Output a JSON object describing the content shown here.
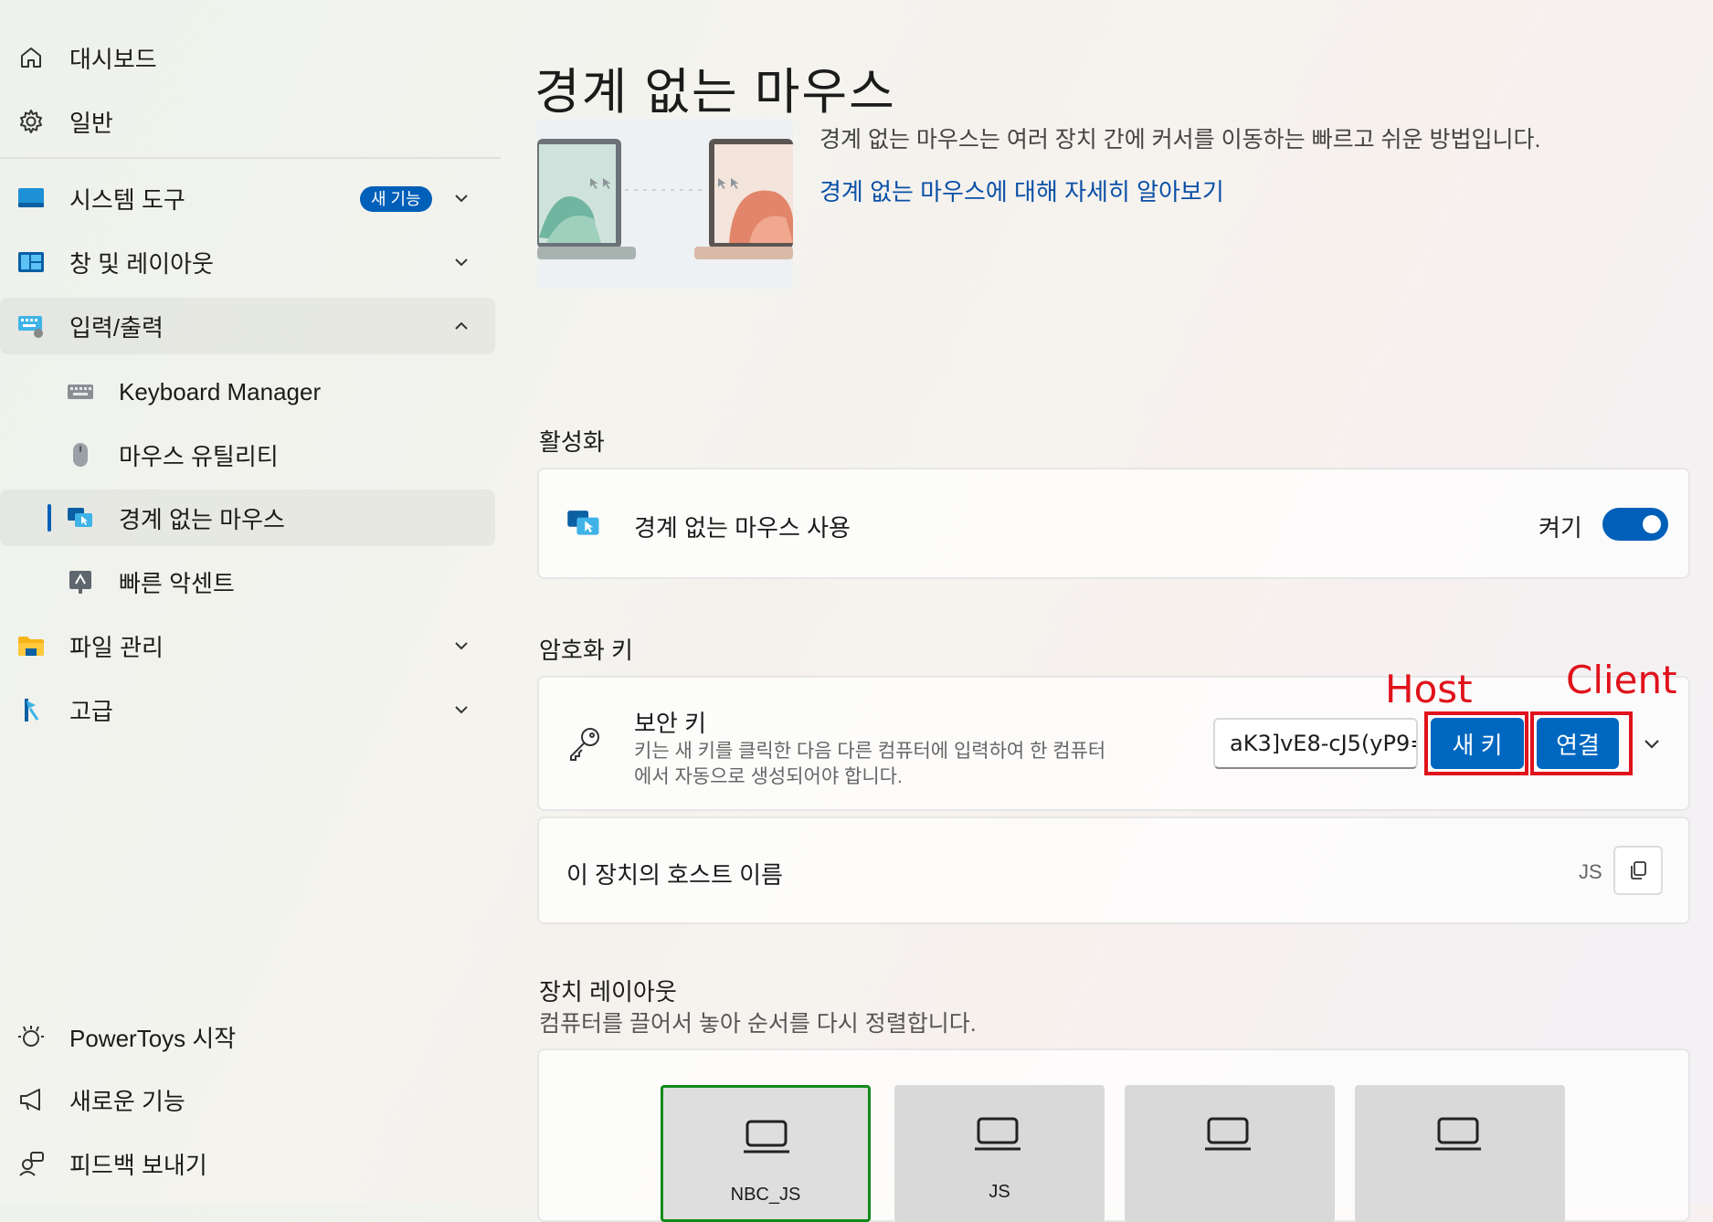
{
  "sidebar": {
    "items": [
      {
        "label": "대시보드",
        "icon": "home-icon"
      },
      {
        "label": "일반",
        "icon": "gear-icon"
      },
      {
        "label": "시스템 도구",
        "icon": "system-tools-icon",
        "badge": "새 기능"
      },
      {
        "label": "창 및 레이아웃",
        "icon": "window-layout-icon"
      },
      {
        "label": "입력/출력",
        "icon": "keyboard-icon",
        "expanded": true
      },
      {
        "label": "Keyboard Manager",
        "icon": "keyboard-manager-icon"
      },
      {
        "label": "마우스 유틸리티",
        "icon": "mouse-icon"
      },
      {
        "label": "경계 없는 마우스",
        "icon": "mouse-without-borders-icon",
        "selected": true
      },
      {
        "label": "빠른 악센트",
        "icon": "quick-accent-icon"
      },
      {
        "label": "파일 관리",
        "icon": "folder-icon"
      },
      {
        "label": "고급",
        "icon": "advanced-icon"
      }
    ],
    "footer": [
      {
        "label": "PowerToys 시작",
        "icon": "welcome-icon"
      },
      {
        "label": "새로운 기능",
        "icon": "megaphone-icon"
      },
      {
        "label": "피드백 보내기",
        "icon": "feedback-icon"
      }
    ]
  },
  "page": {
    "title": "경계 없는 마우스",
    "description": "경계 없는 마우스는 여러 장치 간에 커서를 이동하는 빠르고 쉬운 방법입니다.",
    "learn_more": "경계 없는 마우스에 대해 자세히 알아보기"
  },
  "activation": {
    "heading": "활성화",
    "label": "경계 없는 마우스 사용",
    "state_label": "켜기",
    "enabled": true
  },
  "encryption": {
    "heading": "암호화 키",
    "title": "보안 키",
    "desc_line1": "키는 새 키를 클릭한 다음 다른 컴퓨터에 입력하여 한 컴퓨터",
    "desc_line2": "에서 자동으로 생성되어야 합니다.",
    "key_value": "aK3]vE8-cJ5(yP9=",
    "new_key_label": "새 키",
    "connect_label": "연결"
  },
  "annotations": {
    "host": "Host",
    "client": "Client",
    "color": "#e0121b"
  },
  "hostname": {
    "label": "이 장치의 호스트 이름",
    "value": "JS"
  },
  "device_layout": {
    "heading": "장치 레이아웃",
    "subtitle": "컴퓨터를 끌어서 놓아 순서를 다시 정렬합니다.",
    "devices": [
      {
        "name": "NBC_JS",
        "active": true
      },
      {
        "name": "JS",
        "active": false
      },
      {
        "name": "",
        "active": false
      },
      {
        "name": "",
        "active": false
      }
    ]
  },
  "colors": {
    "accent": "#005fb8",
    "link": "#0a4fa6",
    "active_device_border": "#118a1b"
  }
}
